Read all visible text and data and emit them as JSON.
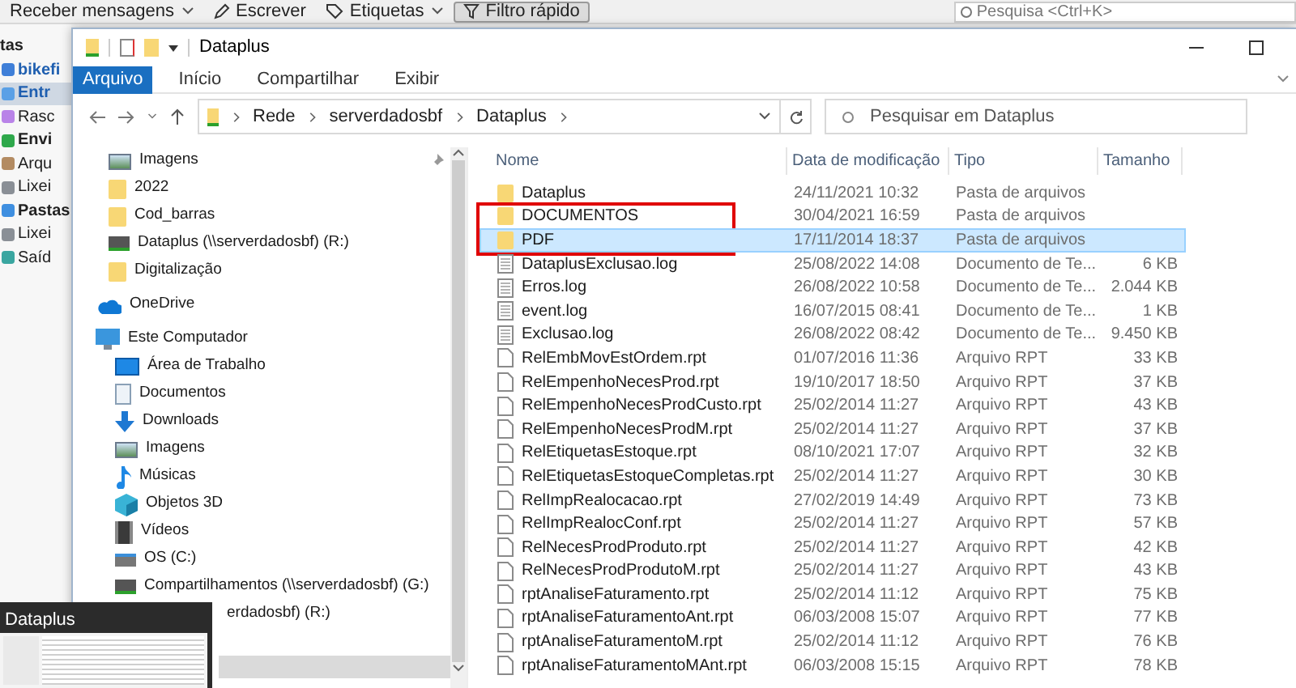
{
  "background_app": {
    "toolbar": [
      {
        "label": "Receber mensagens",
        "kind": "receive",
        "pressed": false
      },
      {
        "label": "Escrever",
        "kind": "compose",
        "pressed": false
      },
      {
        "label": "Etiquetas",
        "kind": "tags",
        "pressed": false
      },
      {
        "label": "Filtro rápido",
        "kind": "filter",
        "pressed": true
      }
    ],
    "search": {
      "placeholder": "Pesquisa <Ctrl+K>"
    },
    "folder_header": "tas",
    "folders": [
      {
        "label": "bikefi",
        "kind": "account",
        "selected": false
      },
      {
        "label": "Entr",
        "kind": "inbox",
        "selected": true
      },
      {
        "label": "Rasc",
        "kind": "drafts",
        "selected": false
      },
      {
        "label": "Envi",
        "kind": "sent",
        "selected": false
      },
      {
        "label": "Arqu",
        "kind": "archive",
        "selected": false
      },
      {
        "label": "Lixei",
        "kind": "trash",
        "selected": false
      },
      {
        "label": "Pastas",
        "kind": "local",
        "selected": false
      },
      {
        "label": "Lixei",
        "kind": "trash",
        "selected": false
      },
      {
        "label": "Saíd",
        "kind": "outbox",
        "selected": false
      }
    ]
  },
  "explorer": {
    "title": "Dataplus",
    "ribbon_tabs": [
      {
        "label": "Arquivo",
        "selected": true
      },
      {
        "label": "Início",
        "selected": false
      },
      {
        "label": "Compartilhar",
        "selected": false
      },
      {
        "label": "Exibir",
        "selected": false
      }
    ],
    "breadcrumb": [
      "Rede",
      "serverdadosbf",
      "Dataplus"
    ],
    "search": {
      "placeholder": "Pesquisar em Dataplus"
    },
    "nav": [
      {
        "label": "Imagens",
        "kind": "pictures",
        "pinned": true
      },
      {
        "label": "2022",
        "kind": "folder",
        "pinned": false
      },
      {
        "label": "Cod_barras",
        "kind": "folder",
        "pinned": false
      },
      {
        "label": "Dataplus (\\\\serverdadosbf) (R:)",
        "kind": "network-drive",
        "pinned": false
      },
      {
        "label": "Digitalização",
        "kind": "folder",
        "pinned": false
      },
      {
        "label": "OneDrive",
        "kind": "cloud",
        "pinned": false
      },
      {
        "label": "Este Computador",
        "kind": "computer",
        "pinned": false,
        "children": [
          {
            "label": "Área de Trabalho",
            "kind": "desktop",
            "pinned": false
          },
          {
            "label": "Documentos",
            "kind": "documents",
            "pinned": false
          },
          {
            "label": "Downloads",
            "kind": "downloads",
            "pinned": false
          },
          {
            "label": "Imagens",
            "kind": "pictures",
            "pinned": false
          },
          {
            "label": "Músicas",
            "kind": "music",
            "pinned": false
          },
          {
            "label": "Objetos 3D",
            "kind": "objects3d",
            "pinned": false
          },
          {
            "label": "Vídeos",
            "kind": "videos",
            "pinned": false
          },
          {
            "label": "OS (C:)",
            "kind": "drive",
            "pinned": false
          },
          {
            "label": "Compartilhamentos (\\\\serverdadosbf) (G:)",
            "kind": "network-drive",
            "pinned": false
          },
          {
            "label": "erdadosbf) (R:)",
            "kind": "partial",
            "pinned": false
          }
        ]
      }
    ],
    "columns": [
      "Nome",
      "Data de modificação",
      "Tipo",
      "Tamanho"
    ],
    "files": [
      {
        "name": "Dataplus",
        "date": "24/11/2021 10:32",
        "type": "Pasta de arquivos",
        "kind": "folder",
        "selected": false
      },
      {
        "name": "DOCUMENTOS",
        "date": "30/04/2021 16:59",
        "type": "Pasta de arquivos",
        "kind": "folder",
        "selected": false
      },
      {
        "name": "PDF",
        "date": "17/11/2014 18:37",
        "type": "Pasta de arquivos",
        "kind": "folder",
        "selected": true
      },
      {
        "name": "DataplusExclusao.log",
        "date": "25/08/2022 14:08",
        "type": "Documento de Te...",
        "size": "6 KB",
        "kind": "text",
        "selected": false
      },
      {
        "name": "Erros.log",
        "date": "26/08/2022 10:58",
        "type": "Documento de Te...",
        "size": "2.044 KB",
        "kind": "text",
        "selected": false
      },
      {
        "name": "event.log",
        "date": "16/07/2015 08:41",
        "type": "Documento de Te...",
        "size": "1 KB",
        "kind": "text",
        "selected": false
      },
      {
        "name": "Exclusao.log",
        "date": "26/08/2022 08:42",
        "type": "Documento de Te...",
        "size": "9.450 KB",
        "kind": "text",
        "selected": false
      },
      {
        "name": "RelEmbMovEstOrdem.rpt",
        "date": "01/07/2016 11:36",
        "type": "Arquivo RPT",
        "size": "33 KB",
        "kind": "file",
        "selected": false
      },
      {
        "name": "RelEmpenhoNecesProd.rpt",
        "date": "19/10/2017 18:50",
        "type": "Arquivo RPT",
        "size": "37 KB",
        "kind": "file",
        "selected": false
      },
      {
        "name": "RelEmpenhoNecesProdCusto.rpt",
        "date": "25/02/2014 11:27",
        "type": "Arquivo RPT",
        "size": "43 KB",
        "kind": "file",
        "selected": false
      },
      {
        "name": "RelEmpenhoNecesProdM.rpt",
        "date": "25/02/2014 11:27",
        "type": "Arquivo RPT",
        "size": "37 KB",
        "kind": "file",
        "selected": false
      },
      {
        "name": "RelEtiquetasEstoque.rpt",
        "date": "08/10/2021 17:07",
        "type": "Arquivo RPT",
        "size": "32 KB",
        "kind": "file",
        "selected": false
      },
      {
        "name": "RelEtiquetasEstoqueCompletas.rpt",
        "date": "25/02/2014 11:27",
        "type": "Arquivo RPT",
        "size": "30 KB",
        "kind": "file",
        "selected": false
      },
      {
        "name": "RelImpRealocacao.rpt",
        "date": "27/02/2019 14:49",
        "type": "Arquivo RPT",
        "size": "73 KB",
        "kind": "file",
        "selected": false
      },
      {
        "name": "RelImpRealocConf.rpt",
        "date": "25/02/2014 11:27",
        "type": "Arquivo RPT",
        "size": "57 KB",
        "kind": "file",
        "selected": false
      },
      {
        "name": "RelNecesProdProduto.rpt",
        "date": "25/02/2014 11:27",
        "type": "Arquivo RPT",
        "size": "42 KB",
        "kind": "file",
        "selected": false
      },
      {
        "name": "RelNecesProdProdutoM.rpt",
        "date": "25/02/2014 11:27",
        "type": "Arquivo RPT",
        "size": "43 KB",
        "kind": "file",
        "selected": false
      },
      {
        "name": "rptAnaliseFaturamento.rpt",
        "date": "25/02/2014 11:12",
        "type": "Arquivo RPT",
        "size": "75 KB",
        "kind": "file",
        "selected": false
      },
      {
        "name": "rptAnaliseFaturamentoAnt.rpt",
        "date": "06/03/2008 15:07",
        "type": "Arquivo RPT",
        "size": "77 KB",
        "kind": "file",
        "selected": false
      },
      {
        "name": "rptAnaliseFaturamentoM.rpt",
        "date": "25/02/2014 11:12",
        "type": "Arquivo RPT",
        "size": "76 KB",
        "kind": "file",
        "selected": false
      },
      {
        "name": "rptAnaliseFaturamentoMAnt.rpt",
        "date": "06/03/2008 15:15",
        "type": "Arquivo RPT",
        "size": "78 KB",
        "kind": "file",
        "selected": false
      }
    ]
  },
  "taskbar_preview": {
    "title": "Dataplus"
  }
}
